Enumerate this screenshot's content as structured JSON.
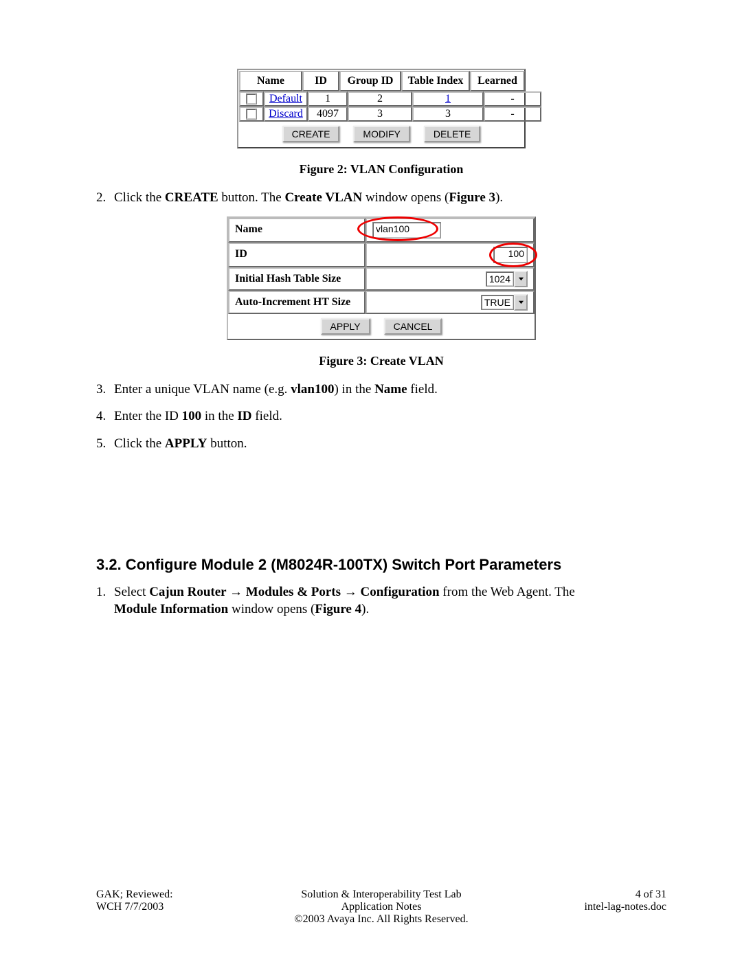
{
  "vlan_table": {
    "headers": {
      "name": "Name",
      "id": "ID",
      "gid": "Group ID",
      "ti": "Table Index",
      "ln": "Learned"
    },
    "rows": [
      {
        "name": "Default",
        "id": "1",
        "gid": "2",
        "ti": "1",
        "ti_link": true,
        "ln": "-"
      },
      {
        "name": "Discard",
        "id": "4097",
        "gid": "3",
        "ti": "3",
        "ti_link": false,
        "ln": "-"
      }
    ],
    "buttons": {
      "create": "CREATE",
      "modify": "MODIFY",
      "delete": "DELETE"
    }
  },
  "fig2_caption": "Figure 2: VLAN Configuration",
  "step2_a": "2.",
  "step2_b": "Click the ",
  "step2_c": "CREATE",
  "step2_d": " button. The ",
  "step2_e": "Create VLAN",
  "step2_f": " window opens (",
  "step2_g": "Figure 3",
  "step2_h": ").",
  "cvx": {
    "labels": {
      "name": "Name",
      "id": "ID",
      "ihts": "Initial Hash Table Size",
      "aiht": "Auto-Increment HT Size"
    },
    "values": {
      "name": "vlan100",
      "id": "100",
      "ihts": "1024",
      "aiht": "TRUE"
    },
    "buttons": {
      "apply": "APPLY",
      "cancel": "CANCEL"
    }
  },
  "fig3_caption": "Figure 3: Create VLAN",
  "step3": {
    "n": "3.",
    "a": "Enter a unique VLAN name (e.g. ",
    "b": "vlan100",
    "c": ") in the ",
    "d": "Name",
    "e": " field."
  },
  "step4": {
    "n": "4.",
    "a": "Enter the ID ",
    "b": "100",
    "c": " in the ",
    "d": "ID",
    "e": " field."
  },
  "step5": {
    "n": "5.",
    "a": "Click the ",
    "b": "APPLY",
    "c": " button."
  },
  "section_title": "3.2. Configure Module 2 (M8024R-100TX) Switch Port Parameters",
  "sect_step1": {
    "n": "1.",
    "a": "Select ",
    "b": "Cajun Router ",
    "arrow": "→",
    "c": " Modules & Ports ",
    "d": " Configuration",
    "e": " from the Web Agent.  The ",
    "f": "Module Information",
    "g": " window opens (",
    "h": "Figure 4",
    "i": ")."
  },
  "footer": {
    "left1": "GAK; Reviewed:",
    "left2": "WCH 7/7/2003",
    "mid1": "Solution & Interoperability Test Lab Application Notes",
    "mid2": "©2003 Avaya Inc. All Rights Reserved.",
    "right1": "4 of 31",
    "right2": "intel-lag-notes.doc"
  }
}
